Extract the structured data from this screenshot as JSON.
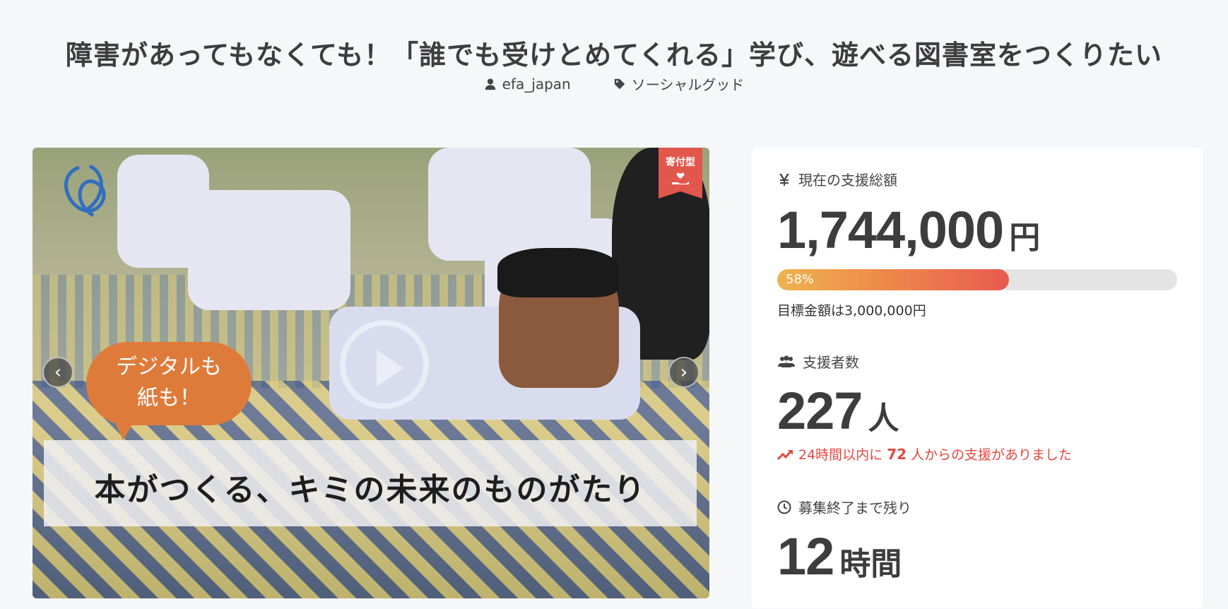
{
  "project": {
    "title": "障害があってもなくても！「誰でも受けとめてくれる」学び、遊べる図書室をつくりたい",
    "author": "efa_japan",
    "category": "ソーシャルグッド"
  },
  "hero": {
    "badge": "寄付型",
    "bubble_line1": "デジタルも",
    "bubble_line2": "紙も！",
    "caption": "本がつくる、キミの未来のものがたり",
    "prev_label": "‹",
    "next_label": "›"
  },
  "stats": {
    "total_label": "現在の支援総額",
    "total_amount": "1,744,000",
    "total_unit": "円",
    "progress_percent": 58,
    "progress_label": "58%",
    "goal_text": "目標金額は3,000,000円",
    "supporters_label": "支援者数",
    "supporters_count": "227",
    "supporters_unit": "人",
    "recent_prefix": "24時間以内に",
    "recent_count": "72",
    "recent_suffix": "人からの支援がありました",
    "remaining_label": "募集終了まで残り",
    "remaining_value": "12",
    "remaining_unit": "時間"
  },
  "colors": {
    "accent_red": "#e4473d",
    "badge_red": "#e2574c",
    "bubble_orange": "#de7b3b"
  },
  "icons": {
    "author": "user-icon",
    "category": "tag-icon",
    "total": "yen-icon",
    "supporters": "users-icon",
    "trend": "trend-up-icon",
    "remaining": "clock-icon"
  }
}
